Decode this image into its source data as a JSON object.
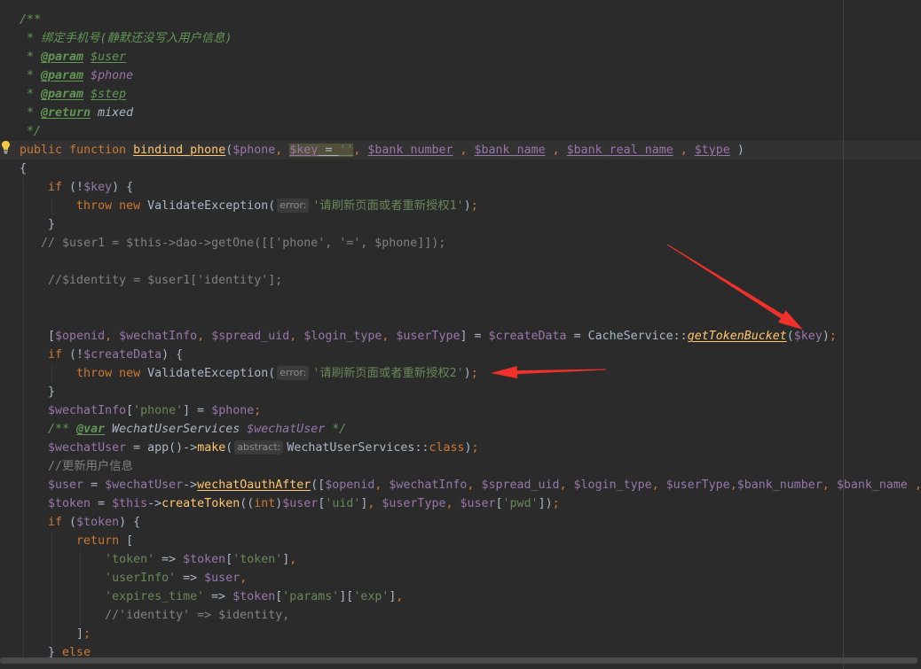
{
  "theme": {
    "background": "#2B2B2B",
    "current_line": "#323232",
    "text": "#A9B7C6",
    "keyword": "#CC7832",
    "variable": "#9876AA",
    "string": "#6A8759",
    "comment": "#808080",
    "function": "#FFC66D",
    "doc_comment": "#629755",
    "annotation": "#F0302A"
  },
  "icons": {
    "intention": "lightbulb-icon",
    "annotation": "red-arrow"
  },
  "editor": {
    "lines": [
      {
        "tokens": [
          {
            "t": "/**",
            "c": "doc"
          }
        ]
      },
      {
        "tokens": [
          {
            "t": " * 绑定手机号(静默还没写入用户信息)",
            "c": "doc"
          }
        ]
      },
      {
        "tokens": [
          {
            "t": " * ",
            "c": "doc"
          },
          {
            "t": "@param",
            "c": "dtag"
          },
          {
            "t": " ",
            "c": "doc"
          },
          {
            "t": "$user",
            "c": "doc u"
          }
        ]
      },
      {
        "tokens": [
          {
            "t": " * ",
            "c": "doc"
          },
          {
            "t": "@param",
            "c": "dtag"
          },
          {
            "t": " ",
            "c": "doc"
          },
          {
            "t": "$phone",
            "c": "dvar"
          }
        ]
      },
      {
        "tokens": [
          {
            "t": " * ",
            "c": "doc"
          },
          {
            "t": "@param",
            "c": "dtag"
          },
          {
            "t": " ",
            "c": "doc"
          },
          {
            "t": "$step",
            "c": "doc u"
          }
        ]
      },
      {
        "tokens": [
          {
            "t": " * ",
            "c": "doc"
          },
          {
            "t": "@return",
            "c": "dtag"
          },
          {
            "t": " ",
            "c": "doc"
          },
          {
            "t": "mixed",
            "c": "dtype"
          }
        ]
      },
      {
        "tokens": [
          {
            "t": " */",
            "c": "doc"
          }
        ]
      },
      {
        "tokens": [
          {
            "t": "public",
            "c": "kw"
          },
          {
            "t": " ",
            "c": "p"
          },
          {
            "t": "function",
            "c": "kw"
          },
          {
            "t": " ",
            "c": "p"
          },
          {
            "t": "bindind_phone",
            "c": "fn u"
          },
          {
            "t": "(",
            "c": "p"
          },
          {
            "t": "$phone",
            "c": "var"
          },
          {
            "t": ",",
            "c": "sep"
          },
          {
            "t": " ",
            "c": "p"
          },
          {
            "t": "$key",
            "c": "var hl u"
          },
          {
            "t": " = ",
            "c": "p hl u"
          },
          {
            "t": "''",
            "c": "str hl u"
          },
          {
            "t": ",",
            "c": "sep"
          },
          {
            "t": " ",
            "c": "p"
          },
          {
            "t": "$bank_number",
            "c": "var u"
          },
          {
            "t": " ",
            "c": "p"
          },
          {
            "t": ",",
            "c": "sep"
          },
          {
            "t": " ",
            "c": "p"
          },
          {
            "t": "$bank_name",
            "c": "var u"
          },
          {
            "t": " ",
            "c": "p"
          },
          {
            "t": ",",
            "c": "sep"
          },
          {
            "t": " ",
            "c": "p"
          },
          {
            "t": "$bank_real_name",
            "c": "var u"
          },
          {
            "t": " ",
            "c": "p"
          },
          {
            "t": ",",
            "c": "sep"
          },
          {
            "t": " ",
            "c": "p"
          },
          {
            "t": "$type",
            "c": "var u"
          },
          {
            "t": " )",
            "c": "p"
          }
        ]
      },
      {
        "tokens": [
          {
            "t": "{",
            "c": "p"
          }
        ]
      },
      {
        "tokens": [
          {
            "t": "    ",
            "c": "ws"
          },
          {
            "t": "if",
            "c": "kw"
          },
          {
            "t": " (!",
            "c": "p"
          },
          {
            "t": "$key",
            "c": "var"
          },
          {
            "t": ") {",
            "c": "p"
          }
        ]
      },
      {
        "tokens": [
          {
            "t": "        ",
            "c": "ws"
          },
          {
            "t": "throw",
            "c": "kw"
          },
          {
            "t": " ",
            "c": "p"
          },
          {
            "t": "new",
            "c": "kw"
          },
          {
            "t": " ",
            "c": "p"
          },
          {
            "t": "ValidateException",
            "c": "cls"
          },
          {
            "t": "(",
            "c": "p"
          },
          {
            "t": "error:",
            "c": "hint"
          },
          {
            "t": "'请刷新页面或者重新授权1'",
            "c": "str"
          },
          {
            "t": ")",
            "c": "p"
          },
          {
            "t": ";",
            "c": "sep"
          }
        ]
      },
      {
        "tokens": [
          {
            "t": "    ",
            "c": "ws"
          },
          {
            "t": "}",
            "c": "p"
          }
        ]
      },
      {
        "tokens": [
          {
            "t": "   ",
            "c": "ws"
          },
          {
            "t": "// $user1 = $this->dao->getOne([['phone', '=', $phone]]);",
            "c": "cmt"
          }
        ]
      },
      {
        "tokens": []
      },
      {
        "tokens": [
          {
            "t": "    ",
            "c": "ws"
          },
          {
            "t": "//$identity = $user1['identity'];",
            "c": "cmt"
          }
        ]
      },
      {
        "tokens": []
      },
      {
        "tokens": []
      },
      {
        "tokens": [
          {
            "t": "    ",
            "c": "ws"
          },
          {
            "t": "[",
            "c": "p"
          },
          {
            "t": "$openid",
            "c": "var"
          },
          {
            "t": ",",
            "c": "sep"
          },
          {
            "t": " ",
            "c": "p"
          },
          {
            "t": "$wechatInfo",
            "c": "var"
          },
          {
            "t": ",",
            "c": "sep"
          },
          {
            "t": " ",
            "c": "p"
          },
          {
            "t": "$spread_uid",
            "c": "var"
          },
          {
            "t": ",",
            "c": "sep"
          },
          {
            "t": " ",
            "c": "p"
          },
          {
            "t": "$login_type",
            "c": "var"
          },
          {
            "t": ",",
            "c": "sep"
          },
          {
            "t": " ",
            "c": "p"
          },
          {
            "t": "$userType",
            "c": "var"
          },
          {
            "t": "] = ",
            "c": "p"
          },
          {
            "t": "$createData",
            "c": "var"
          },
          {
            "t": " = ",
            "c": "p"
          },
          {
            "t": "CacheService",
            "c": "cls"
          },
          {
            "t": "::",
            "c": "p"
          },
          {
            "t": "getTokenBucket",
            "c": "fn it u"
          },
          {
            "t": "(",
            "c": "p"
          },
          {
            "t": "$key",
            "c": "var"
          },
          {
            "t": ")",
            "c": "p"
          },
          {
            "t": ";",
            "c": "sep"
          }
        ]
      },
      {
        "tokens": [
          {
            "t": "    ",
            "c": "ws"
          },
          {
            "t": "if",
            "c": "kw"
          },
          {
            "t": " (!",
            "c": "p"
          },
          {
            "t": "$createData",
            "c": "var"
          },
          {
            "t": ") {",
            "c": "p"
          }
        ]
      },
      {
        "tokens": [
          {
            "t": "        ",
            "c": "ws"
          },
          {
            "t": "throw",
            "c": "kw"
          },
          {
            "t": " ",
            "c": "p"
          },
          {
            "t": "new",
            "c": "kw"
          },
          {
            "t": " ",
            "c": "p"
          },
          {
            "t": "ValidateException",
            "c": "cls"
          },
          {
            "t": "(",
            "c": "p"
          },
          {
            "t": "error:",
            "c": "hint"
          },
          {
            "t": "'请刷新页面或者重新授权2'",
            "c": "str"
          },
          {
            "t": ")",
            "c": "p"
          },
          {
            "t": ";",
            "c": "sep"
          }
        ]
      },
      {
        "tokens": [
          {
            "t": "    ",
            "c": "ws"
          },
          {
            "t": "}",
            "c": "p"
          }
        ]
      },
      {
        "tokens": [
          {
            "t": "    ",
            "c": "ws"
          },
          {
            "t": "$wechatInfo",
            "c": "var"
          },
          {
            "t": "[",
            "c": "p"
          },
          {
            "t": "'phone'",
            "c": "str"
          },
          {
            "t": "] = ",
            "c": "p"
          },
          {
            "t": "$phone",
            "c": "var"
          },
          {
            "t": ";",
            "c": "sep"
          }
        ]
      },
      {
        "tokens": [
          {
            "t": "    ",
            "c": "ws"
          },
          {
            "t": "/** ",
            "c": "doc"
          },
          {
            "t": "@var",
            "c": "dtag"
          },
          {
            "t": " ",
            "c": "doc"
          },
          {
            "t": "WechatUserServices",
            "c": "dtype"
          },
          {
            "t": " ",
            "c": "doc"
          },
          {
            "t": "$wechatUser",
            "c": "dvar"
          },
          {
            "t": " */",
            "c": "doc"
          }
        ]
      },
      {
        "tokens": [
          {
            "t": "    ",
            "c": "ws"
          },
          {
            "t": "$wechatUser",
            "c": "var"
          },
          {
            "t": " = ",
            "c": "p"
          },
          {
            "t": "app",
            "c": "p"
          },
          {
            "t": "()->",
            "c": "p"
          },
          {
            "t": "make",
            "c": "fn"
          },
          {
            "t": "(",
            "c": "p"
          },
          {
            "t": "abstract:",
            "c": "hint"
          },
          {
            "t": "WechatUserServices",
            "c": "cls"
          },
          {
            "t": "::",
            "c": "p"
          },
          {
            "t": "class",
            "c": "kw"
          },
          {
            "t": ")",
            "c": "p"
          },
          {
            "t": ";",
            "c": "sep"
          }
        ]
      },
      {
        "tokens": [
          {
            "t": "    ",
            "c": "ws"
          },
          {
            "t": "//更新用户信息",
            "c": "cmt"
          }
        ]
      },
      {
        "tokens": [
          {
            "t": "    ",
            "c": "ws"
          },
          {
            "t": "$user",
            "c": "var"
          },
          {
            "t": " = ",
            "c": "p"
          },
          {
            "t": "$wechatUser",
            "c": "var"
          },
          {
            "t": "->",
            "c": "p"
          },
          {
            "t": "wechatOauthAfter",
            "c": "fn u"
          },
          {
            "t": "([",
            "c": "p"
          },
          {
            "t": "$openid",
            "c": "var"
          },
          {
            "t": ",",
            "c": "sep"
          },
          {
            "t": " ",
            "c": "p"
          },
          {
            "t": "$wechatInfo",
            "c": "var"
          },
          {
            "t": ",",
            "c": "sep"
          },
          {
            "t": " ",
            "c": "p"
          },
          {
            "t": "$spread_uid",
            "c": "var"
          },
          {
            "t": ",",
            "c": "sep"
          },
          {
            "t": " ",
            "c": "p"
          },
          {
            "t": "$login_type",
            "c": "var"
          },
          {
            "t": ",",
            "c": "sep"
          },
          {
            "t": " ",
            "c": "p"
          },
          {
            "t": "$userType",
            "c": "var"
          },
          {
            "t": ",",
            "c": "sep"
          },
          {
            "t": "$bank_number",
            "c": "var"
          },
          {
            "t": ",",
            "c": "sep"
          },
          {
            "t": " ",
            "c": "p"
          },
          {
            "t": "$bank_name",
            "c": "var"
          },
          {
            "t": " ",
            "c": "p"
          },
          {
            "t": ",",
            "c": "sep"
          }
        ]
      },
      {
        "tokens": [
          {
            "t": "    ",
            "c": "ws"
          },
          {
            "t": "$token",
            "c": "var"
          },
          {
            "t": " = ",
            "c": "p"
          },
          {
            "t": "$this",
            "c": "var"
          },
          {
            "t": "->",
            "c": "p"
          },
          {
            "t": "createToken",
            "c": "fn"
          },
          {
            "t": "((",
            "c": "p"
          },
          {
            "t": "int",
            "c": "kw"
          },
          {
            "t": ")",
            "c": "p"
          },
          {
            "t": "$user",
            "c": "var"
          },
          {
            "t": "[",
            "c": "p"
          },
          {
            "t": "'uid'",
            "c": "str"
          },
          {
            "t": "]",
            "c": "p"
          },
          {
            "t": ",",
            "c": "sep"
          },
          {
            "t": " ",
            "c": "p"
          },
          {
            "t": "$userType",
            "c": "var"
          },
          {
            "t": ",",
            "c": "sep"
          },
          {
            "t": " ",
            "c": "p"
          },
          {
            "t": "$user",
            "c": "var"
          },
          {
            "t": "[",
            "c": "p"
          },
          {
            "t": "'pwd'",
            "c": "str"
          },
          {
            "t": "])",
            "c": "p"
          },
          {
            "t": ";",
            "c": "sep"
          }
        ]
      },
      {
        "tokens": [
          {
            "t": "    ",
            "c": "ws"
          },
          {
            "t": "if",
            "c": "kw"
          },
          {
            "t": " (",
            "c": "p"
          },
          {
            "t": "$token",
            "c": "var"
          },
          {
            "t": ") {",
            "c": "p"
          }
        ]
      },
      {
        "tokens": [
          {
            "t": "        ",
            "c": "ws"
          },
          {
            "t": "return",
            "c": "kw"
          },
          {
            "t": " [",
            "c": "p"
          }
        ]
      },
      {
        "tokens": [
          {
            "t": "            ",
            "c": "ws"
          },
          {
            "t": "'token'",
            "c": "str"
          },
          {
            "t": " => ",
            "c": "p"
          },
          {
            "t": "$token",
            "c": "var"
          },
          {
            "t": "[",
            "c": "p"
          },
          {
            "t": "'token'",
            "c": "str"
          },
          {
            "t": "]",
            "c": "p"
          },
          {
            "t": ",",
            "c": "sep"
          }
        ]
      },
      {
        "tokens": [
          {
            "t": "            ",
            "c": "ws"
          },
          {
            "t": "'userInfo'",
            "c": "str"
          },
          {
            "t": " => ",
            "c": "p"
          },
          {
            "t": "$user",
            "c": "var"
          },
          {
            "t": ",",
            "c": "sep"
          }
        ]
      },
      {
        "tokens": [
          {
            "t": "            ",
            "c": "ws"
          },
          {
            "t": "'expires_time'",
            "c": "str"
          },
          {
            "t": " => ",
            "c": "p"
          },
          {
            "t": "$token",
            "c": "var"
          },
          {
            "t": "[",
            "c": "p"
          },
          {
            "t": "'params'",
            "c": "str"
          },
          {
            "t": "][",
            "c": "p"
          },
          {
            "t": "'exp'",
            "c": "str"
          },
          {
            "t": "]",
            "c": "p"
          },
          {
            "t": ",",
            "c": "sep"
          }
        ]
      },
      {
        "tokens": [
          {
            "t": "            ",
            "c": "ws"
          },
          {
            "t": "//'identity' => $identity,",
            "c": "cmt"
          }
        ]
      },
      {
        "tokens": [
          {
            "t": "        ",
            "c": "ws"
          },
          {
            "t": "]",
            "c": "p"
          },
          {
            "t": ";",
            "c": "sep"
          }
        ]
      },
      {
        "tokens": [
          {
            "t": "    ",
            "c": "ws"
          },
          {
            "t": "} ",
            "c": "p"
          },
          {
            "t": "else",
            "c": "kw"
          }
        ]
      }
    ]
  }
}
